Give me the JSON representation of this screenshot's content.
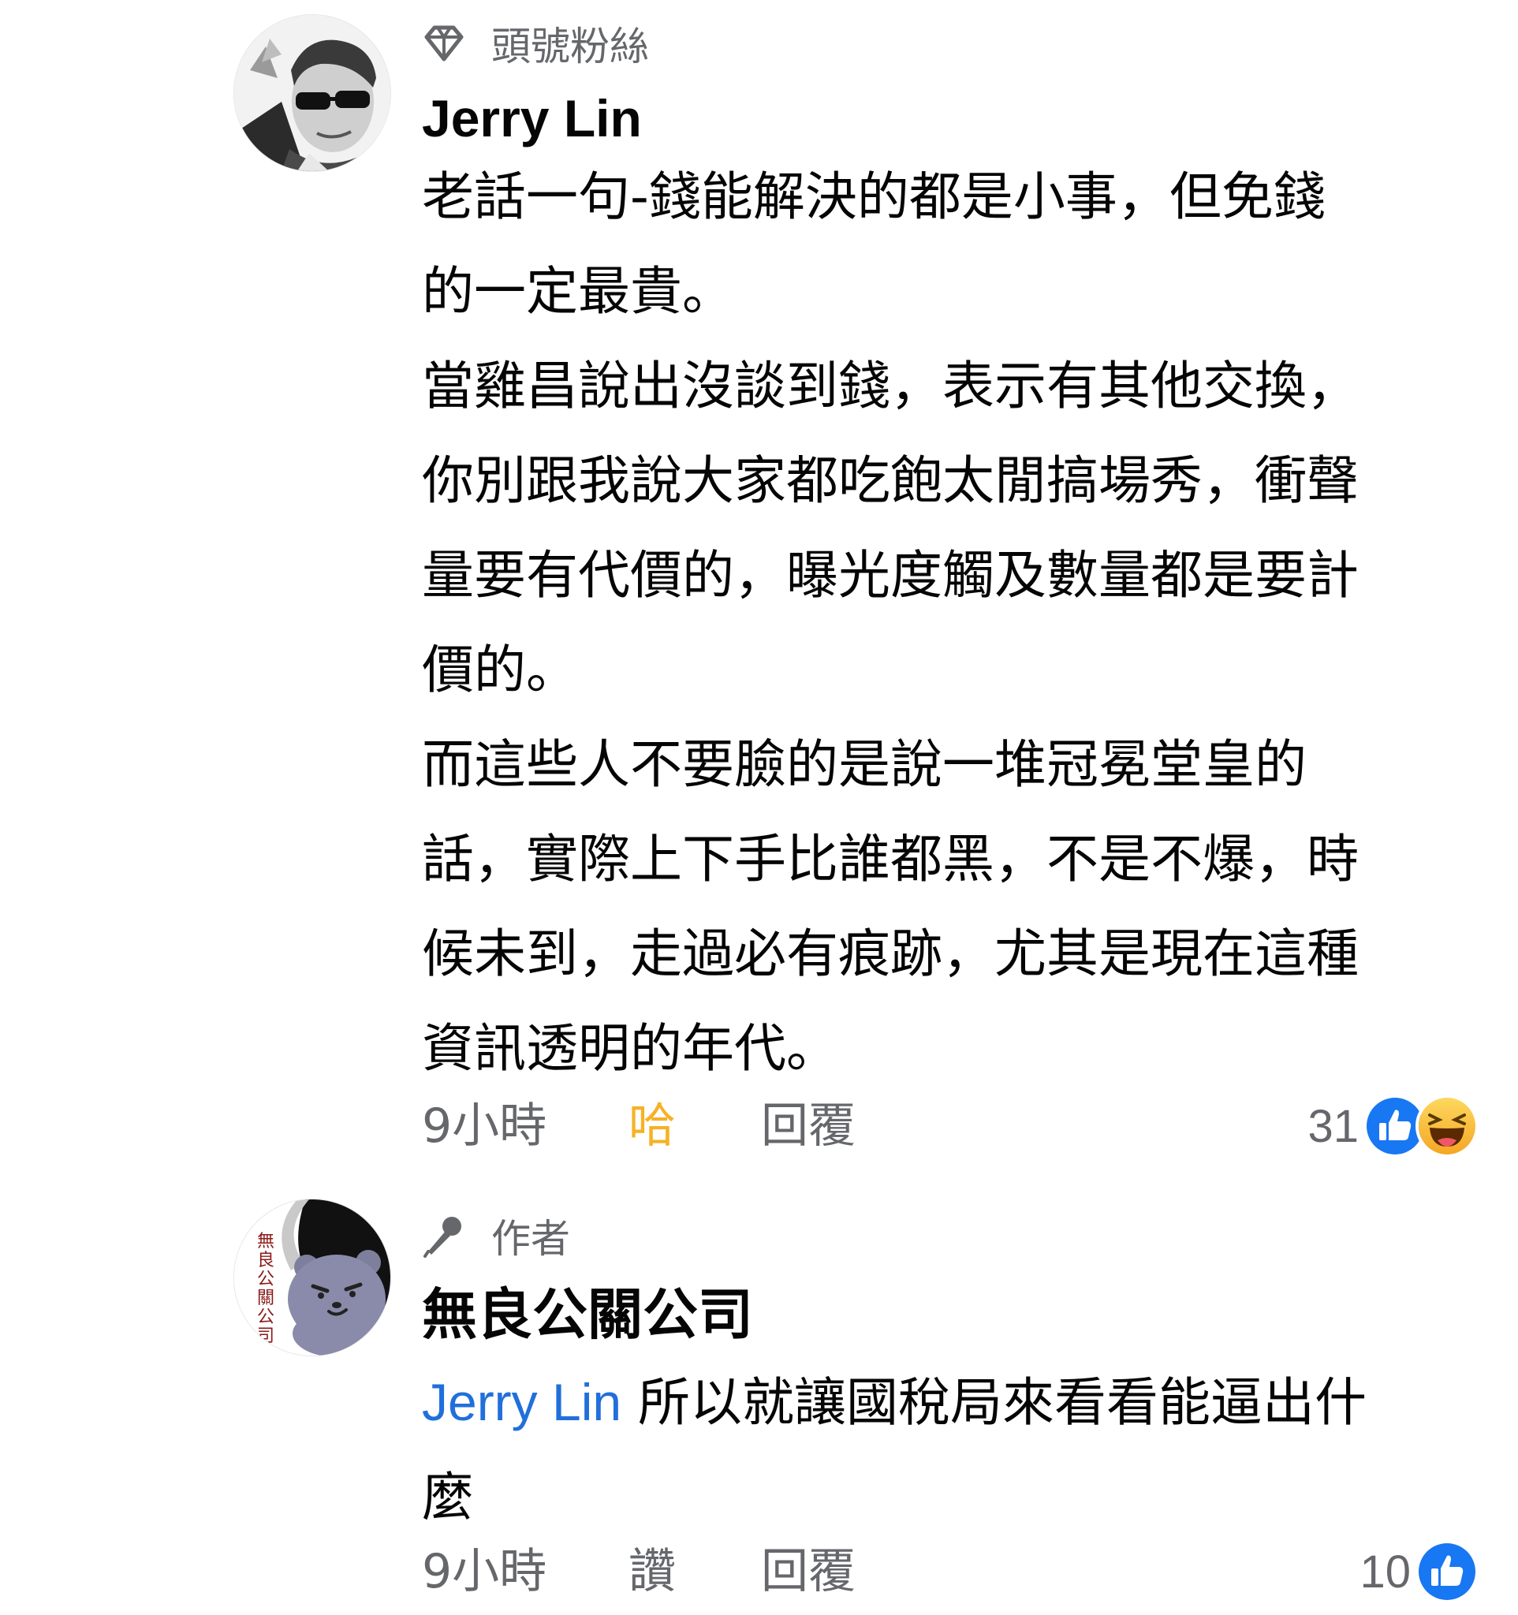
{
  "comments": [
    {
      "badge": "頭號粉絲",
      "badge_icon": "diamond-icon",
      "author": "Jerry Lin",
      "lines": [
        "老話一句-錢能解決的都是小事，但免錢",
        "的一定最貴。",
        "當雞昌說出沒談到錢，表示有其他交換，",
        "你別跟我說大家都吃飽太閒搞場秀，衝聲",
        "量要有代價的，曝光度觸及數量都是要計",
        "價的。",
        "而這些人不要臉的是說一堆冠冕堂皇的",
        "話，實際上下手比誰都黑，不是不爆，時",
        "候未到，走過必有痕跡，尤其是現在這種",
        "資訊透明的年代。"
      ],
      "time": "9小時",
      "reaction_action": "哈",
      "reply": "回覆",
      "reaction_count": "31",
      "reaction_icons": [
        "like-icon",
        "haha-icon"
      ]
    },
    {
      "badge": "作者",
      "badge_icon": "microphone-icon",
      "author": "無良公關公司",
      "avatar_text": "無良公關公司",
      "mention": "Jerry Lin",
      "lines": [
        " 所以就讓國稅局來看看能逼出什",
        "麼"
      ],
      "time": "9小時",
      "reaction_action": "讚",
      "reply": "回覆",
      "reaction_count": "10",
      "reaction_icons": [
        "like-icon"
      ]
    }
  ],
  "colors": {
    "like_blue": "#1877f2",
    "haha_yellow": "#f7b125",
    "mention_blue": "#216fdb",
    "secondary_text": "#65676b"
  }
}
